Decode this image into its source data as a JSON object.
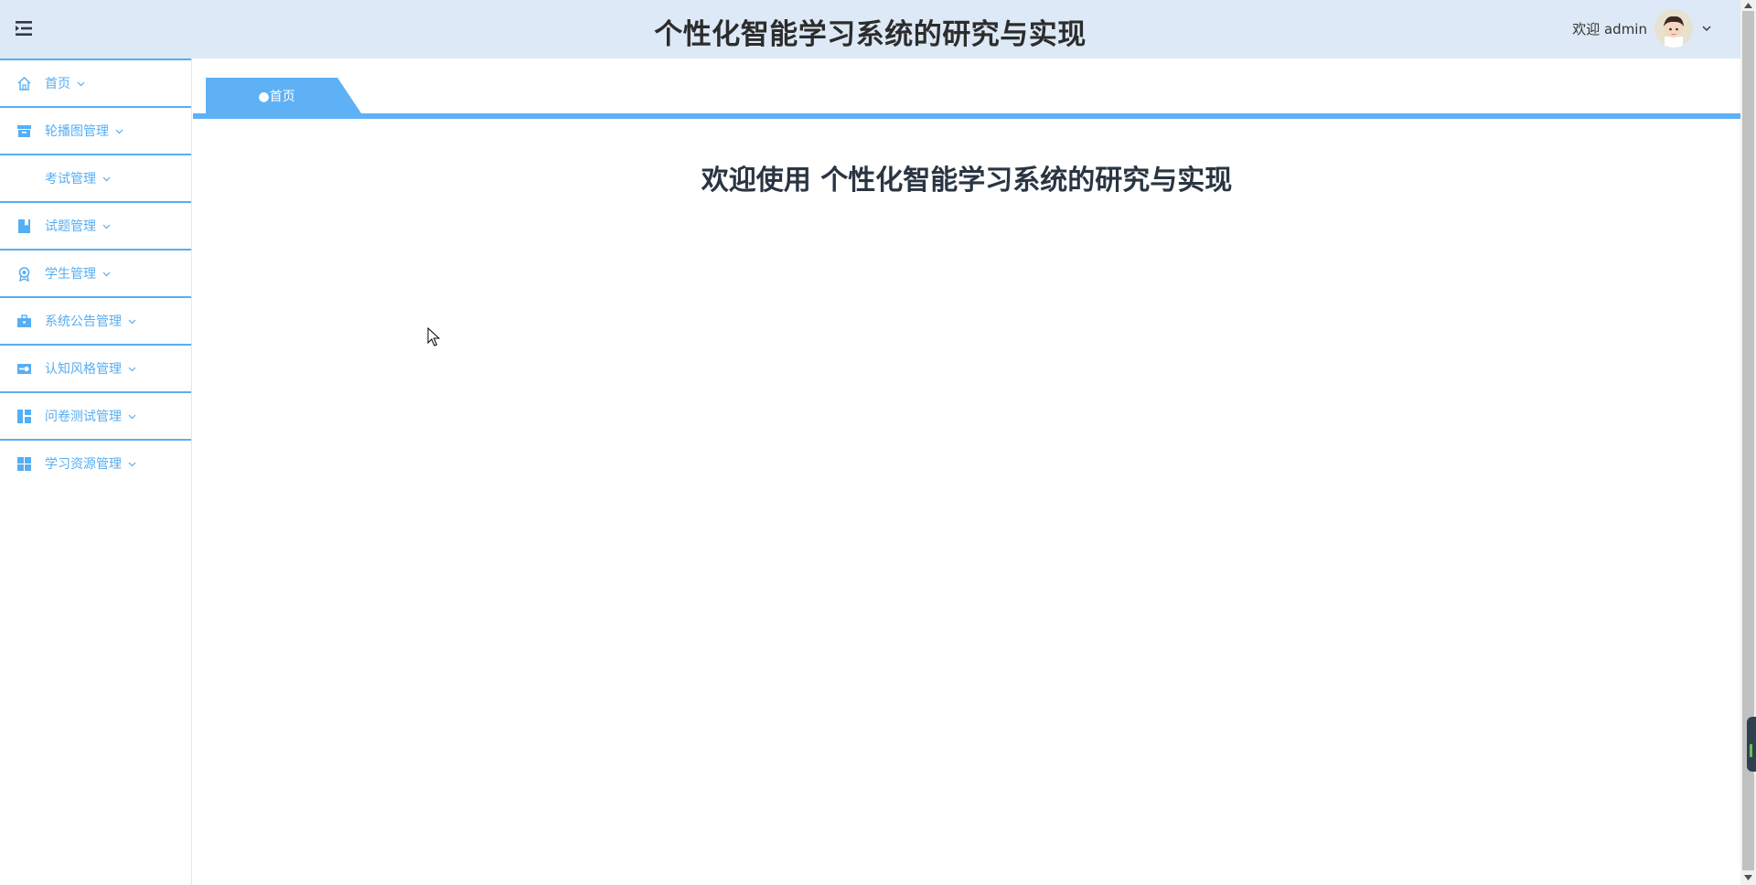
{
  "header": {
    "title": "个性化智能学习系统的研究与实现",
    "welcome": "欢迎 admin",
    "menu_icon": "hamburger-menu-icon",
    "avatar": "user-avatar",
    "header_bg": "#dde9f6"
  },
  "sidebar": {
    "accent_color": "#56aef3",
    "items": [
      {
        "label": "首页",
        "icon": "home-icon"
      },
      {
        "label": "轮播图管理",
        "icon": "carousel-icon"
      },
      {
        "label": "考试管理",
        "icon": ""
      },
      {
        "label": "试题管理",
        "icon": "book-icon"
      },
      {
        "label": "学生管理",
        "icon": "badge-icon"
      },
      {
        "label": "系统公告管理",
        "icon": "briefcase-icon"
      },
      {
        "label": "认知风格管理",
        "icon": "toggle-icon"
      },
      {
        "label": "问卷测试管理",
        "icon": "dashboard-icon"
      },
      {
        "label": "学习资源管理",
        "icon": "grid-icon"
      }
    ]
  },
  "tabs": {
    "active": "●首页",
    "accent_color": "#5eb1f5"
  },
  "main": {
    "welcome_heading": "欢迎使用 个性化智能学习系统的研究与实现"
  }
}
